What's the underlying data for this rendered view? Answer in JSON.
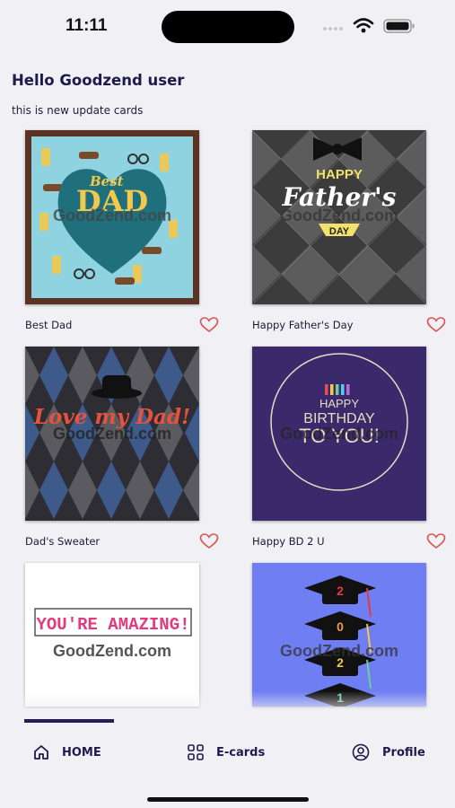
{
  "status": {
    "time": "11:11"
  },
  "greeting": "Hello Goodzend user",
  "subtitle": "this is new update cards",
  "watermark": "GoodZend.com",
  "cards": [
    {
      "title": "Best Dad",
      "art": {
        "line1": "Best",
        "line2": "DAD"
      }
    },
    {
      "title": "Happy Father's Day",
      "art": {
        "line1": "HAPPY",
        "line2": "Father's",
        "line3": "DAY"
      }
    },
    {
      "title": "Dad's Sweater",
      "art": {
        "line1": "Love my Dad!"
      }
    },
    {
      "title": "Happy BD 2 U",
      "art": {
        "line1": "HAPPY",
        "line2": "BIRTHDAY",
        "line3": "TO YOU!"
      }
    },
    {
      "title": "",
      "art": {
        "line1": "YOU'RE AMAZING!"
      }
    },
    {
      "title": "",
      "art": {
        "digits": [
          "2",
          "0",
          "2",
          "1"
        ]
      }
    }
  ],
  "nav": {
    "home": "HOME",
    "ecards": "E-cards",
    "profile": "Profile"
  },
  "colors": {
    "accent": "#231d5c",
    "heart": "#d9534f",
    "background": "#f1f0f4"
  },
  "icons": {
    "home": "home-icon",
    "ecards": "grid-icon",
    "profile": "profile-icon",
    "favorite": "heart-outline-icon"
  }
}
